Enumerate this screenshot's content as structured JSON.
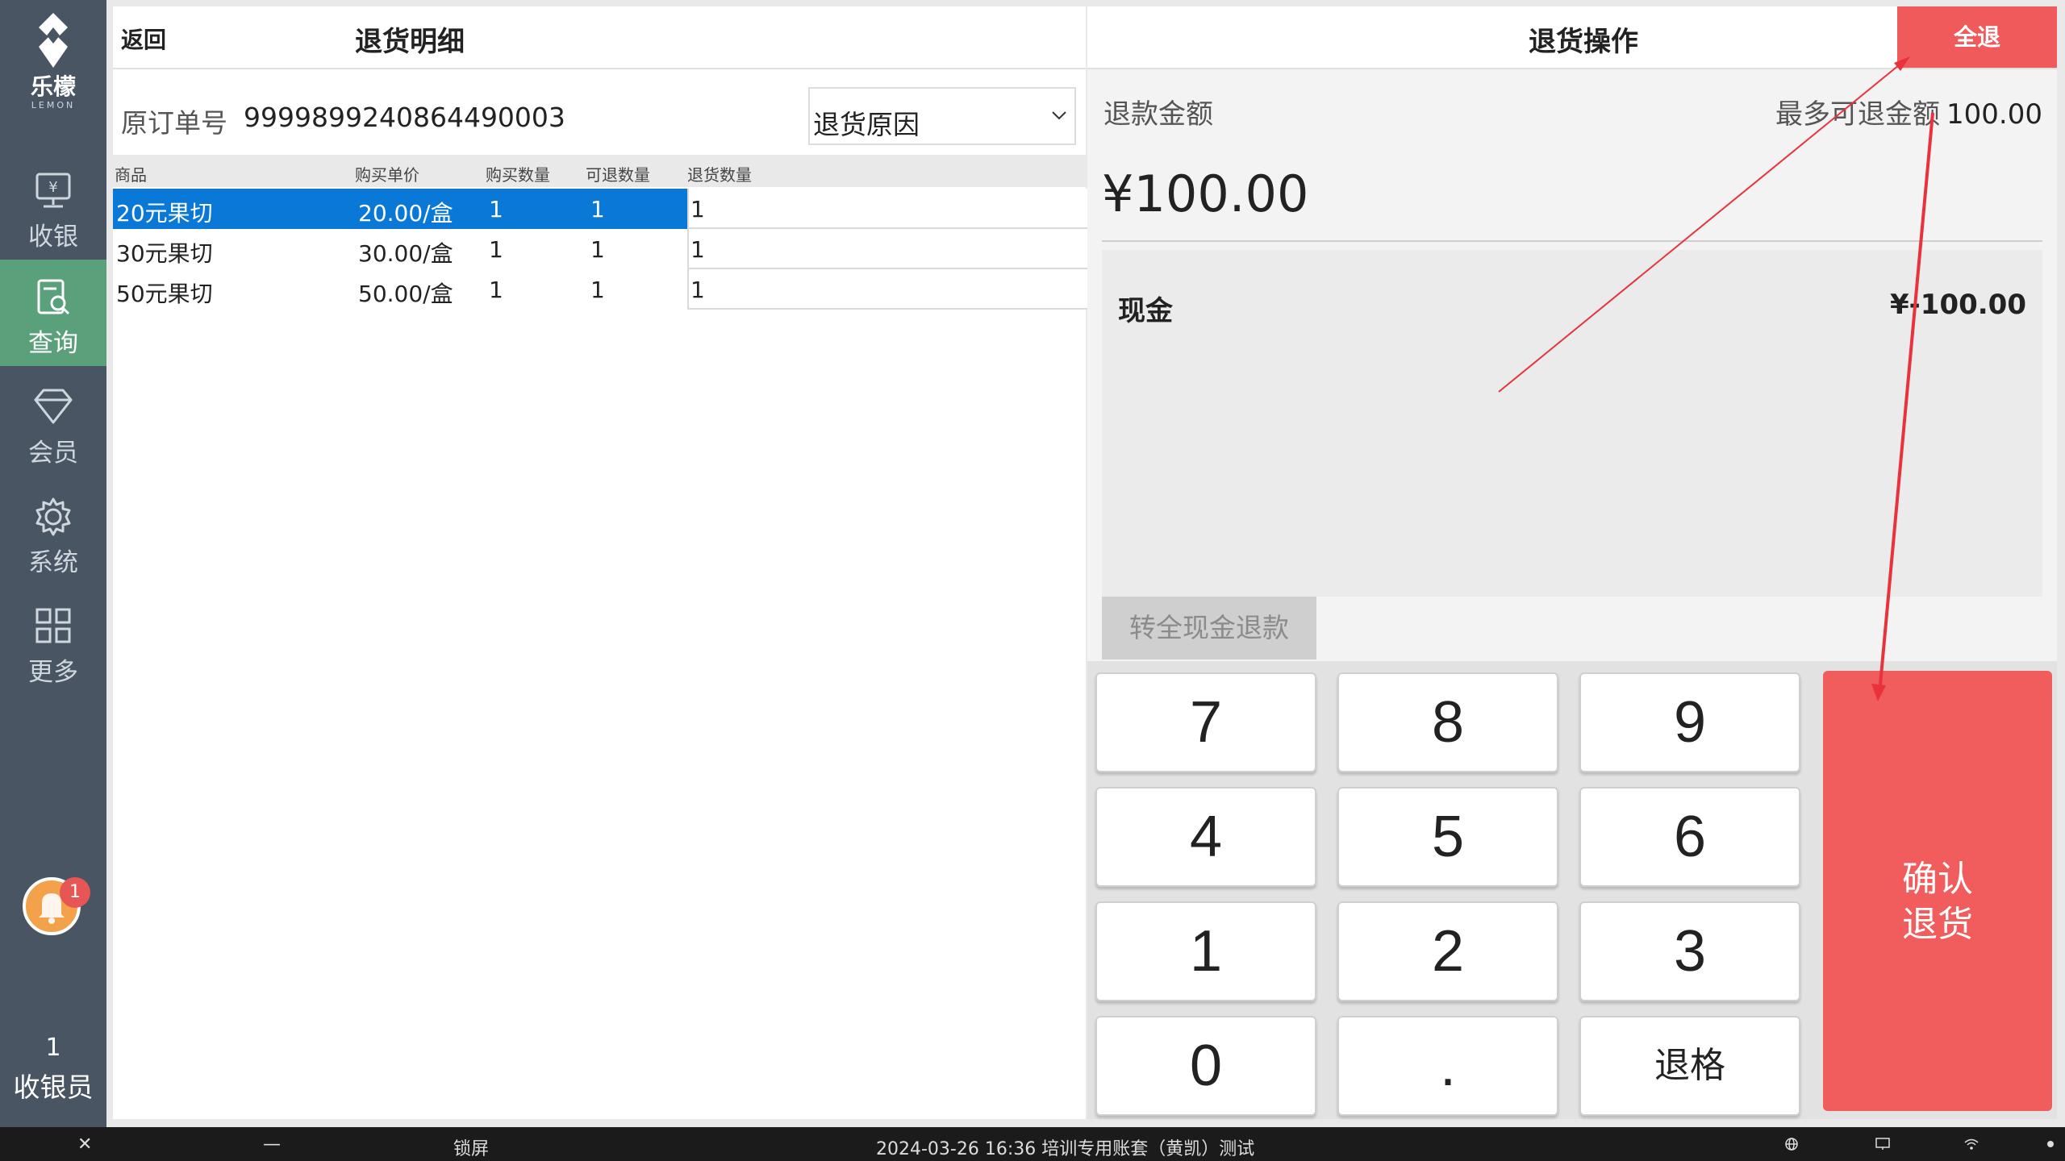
{
  "sidebar": {
    "brand": "乐檬",
    "brand_en": "LEMON",
    "items": [
      {
        "label": "收银",
        "icon": "cash-register-icon"
      },
      {
        "label": "查询",
        "icon": "search-doc-icon",
        "active": true
      },
      {
        "label": "会员",
        "icon": "diamond-icon"
      },
      {
        "label": "系统",
        "icon": "gear-icon"
      },
      {
        "label": "更多",
        "icon": "grid-icon"
      }
    ],
    "notification_badge": "1",
    "user_count": "1",
    "user_role": "收银员",
    "active_color": "#5aa07b"
  },
  "left_panel": {
    "back_label": "返回",
    "title": "退货明细",
    "order_label": "原订单号",
    "order_number": "9999899240864490003",
    "reason_select": "退货原因",
    "columns": [
      "商品",
      "购买单价",
      "购买数量",
      "可退数量",
      "退货数量"
    ],
    "rows": [
      {
        "name": "20元果切",
        "price": "20.00/盒",
        "bought": "1",
        "refundable": "1",
        "refund_qty": "1",
        "selected": true
      },
      {
        "name": "30元果切",
        "price": "30.00/盒",
        "bought": "1",
        "refundable": "1",
        "refund_qty": "1"
      },
      {
        "name": "50元果切",
        "price": "50.00/盒",
        "bought": "1",
        "refundable": "1",
        "refund_qty": "1"
      }
    ],
    "selection_color": "#0a78d7"
  },
  "right_panel": {
    "title": "退货操作",
    "all_refund_label": "全退",
    "refund_label": "退款金额",
    "max_refund_label": "最多可退金额",
    "max_refund_value": "100.00",
    "refund_amount": "¥100.00",
    "payment_name": "现金",
    "payment_amount": "¥-100.00",
    "cash_refund_label": "转全现金退款",
    "keys": [
      "7",
      "8",
      "9",
      "4",
      "5",
      "6",
      "1",
      "2",
      "3",
      "0",
      ".",
      "退格"
    ],
    "confirm_line1": "确认",
    "confirm_line2": "退货",
    "accent_color": "#f15c5c"
  },
  "taskbar": {
    "close": "✕",
    "minimize": "—",
    "lock": "锁屏",
    "status": "2024-03-26 16:36 培训专用账套（黄凯）测试"
  }
}
